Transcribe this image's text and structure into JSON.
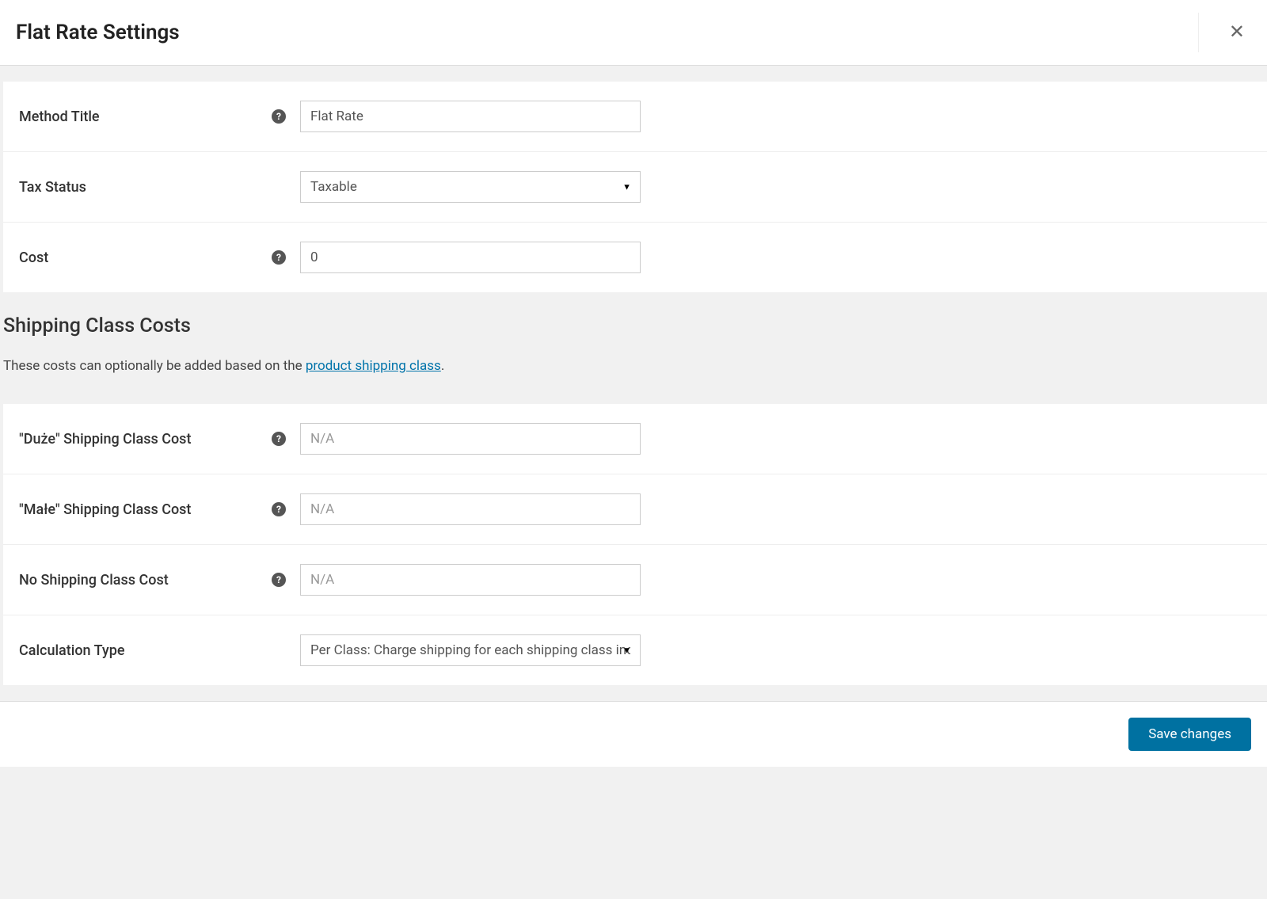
{
  "header": {
    "title": "Flat Rate Settings"
  },
  "fields": {
    "method_title": {
      "label": "Method Title",
      "value": "Flat Rate",
      "has_tip": true
    },
    "tax_status": {
      "label": "Tax Status",
      "value": "Taxable",
      "has_tip": false
    },
    "cost": {
      "label": "Cost",
      "value": "0",
      "has_tip": true
    }
  },
  "section": {
    "heading": "Shipping Class Costs",
    "desc_before": "These costs can optionally be added based on the ",
    "desc_link": "product shipping class",
    "desc_after": "."
  },
  "class_fields": {
    "duze": {
      "label": "\"Duże\" Shipping Class Cost",
      "placeholder": "N/A",
      "value": "",
      "has_tip": true
    },
    "male": {
      "label": "\"Małe\" Shipping Class Cost",
      "placeholder": "N/A",
      "value": "",
      "has_tip": true
    },
    "none": {
      "label": "No Shipping Class Cost",
      "placeholder": "N/A",
      "value": "",
      "has_tip": true
    },
    "calc": {
      "label": "Calculation Type",
      "value": "Per Class: Charge shipping for each shipping class individually",
      "has_tip": false
    }
  },
  "buttons": {
    "save": "Save changes"
  }
}
